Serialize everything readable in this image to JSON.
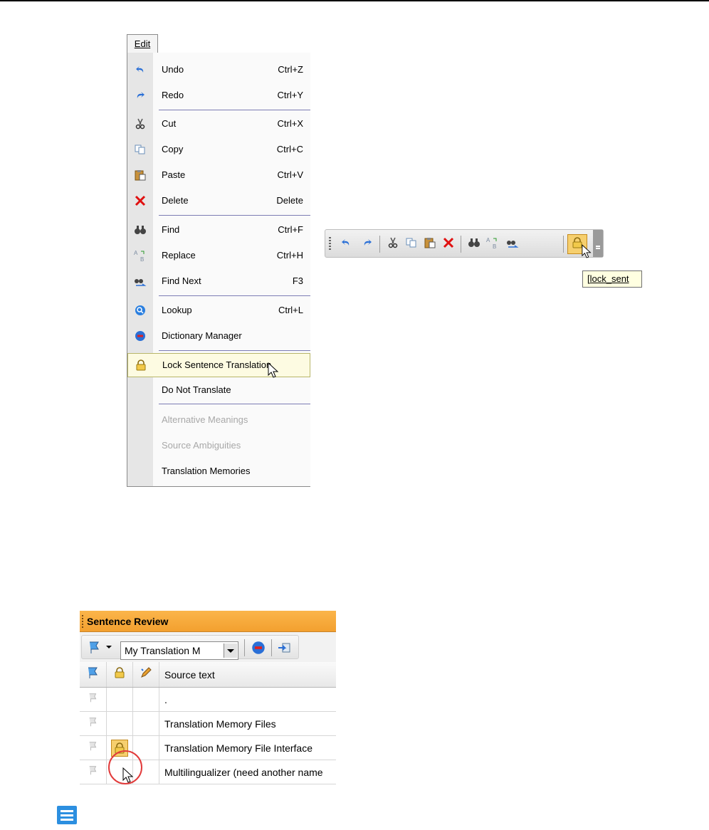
{
  "menu": {
    "title": "Edit",
    "items": [
      {
        "label": "Undo",
        "shortcut": "Ctrl+Z",
        "icon": "undo-icon"
      },
      {
        "label": "Redo",
        "shortcut": "Ctrl+Y",
        "icon": "redo-icon"
      },
      {
        "label": "Cut",
        "shortcut": "Ctrl+X",
        "icon": "cut-icon"
      },
      {
        "label": "Copy",
        "shortcut": "Ctrl+C",
        "icon": "copy-icon"
      },
      {
        "label": "Paste",
        "shortcut": "Ctrl+V",
        "icon": "paste-icon"
      },
      {
        "label": "Delete",
        "shortcut": "Delete",
        "icon": "delete-icon"
      },
      {
        "label": "Find",
        "shortcut": "Ctrl+F",
        "icon": "find-icon"
      },
      {
        "label": "Replace",
        "shortcut": "Ctrl+H",
        "icon": "replace-icon"
      },
      {
        "label": "Find Next",
        "shortcut": "F3",
        "icon": "find-next-icon"
      },
      {
        "label": "Lookup",
        "shortcut": "Ctrl+L",
        "icon": "lookup-icon"
      },
      {
        "label": "Dictionary Manager",
        "shortcut": "",
        "icon": "dictionary-icon"
      },
      {
        "label": "Lock Sentence Translation",
        "shortcut": "",
        "icon": "lock-icon",
        "highlighted": true
      },
      {
        "label": "Do Not Translate",
        "shortcut": ""
      },
      {
        "label": "Alternative Meanings",
        "shortcut": "",
        "disabled": true
      },
      {
        "label": "Source Ambiguities",
        "shortcut": "",
        "disabled": true
      },
      {
        "label": "Translation Memories",
        "shortcut": ""
      }
    ]
  },
  "toolbar": {
    "tooltip": "[lock_sent"
  },
  "sentence_review": {
    "title": "Sentence Review",
    "memory_select": "My Translation M",
    "columns": {
      "source": "Source text"
    },
    "rows": [
      {
        "source": ".",
        "locked": false
      },
      {
        "source": "Translation Memory Files",
        "locked": false
      },
      {
        "source": "Translation Memory File Interface",
        "locked": true
      },
      {
        "source": "Multilingualizer (need another name",
        "locked": false
      }
    ]
  },
  "colors": {
    "accent_orange": "#f3a02f",
    "highlight_ring": "#e23b3b",
    "menu_highlight": "#fdfbe2"
  }
}
